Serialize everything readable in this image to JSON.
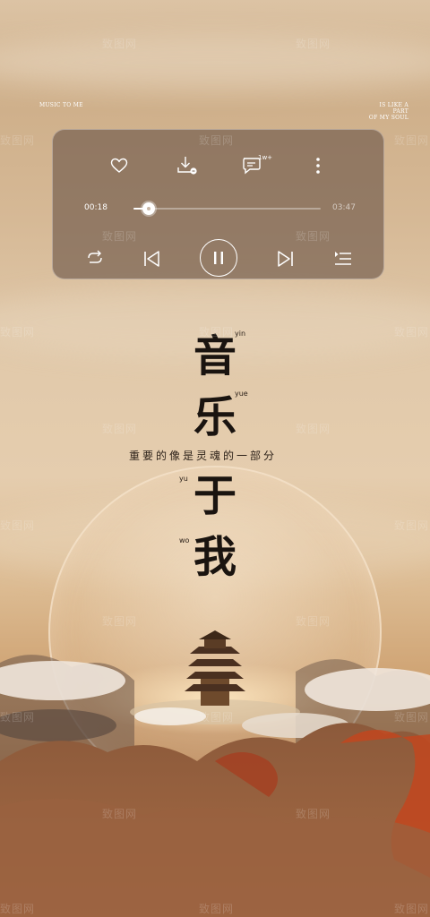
{
  "corner": {
    "left": "MUSIC TO ME",
    "right_line1": "IS LIKE A PART",
    "right_line2": "OF MY SOUL"
  },
  "player": {
    "elapsed": "00:18",
    "total": "03:47",
    "progress": 0.08,
    "comment_count": "1w+",
    "icons": {
      "like": "heart-icon",
      "download": "download-icon",
      "comment": "comment-icon",
      "more": "more-vertical-icon",
      "repeat": "repeat-icon",
      "previous": "skip-previous-icon",
      "pause": "pause-icon",
      "next": "skip-next-icon",
      "playlist": "playlist-icon"
    }
  },
  "title": {
    "chars": [
      "音",
      "乐",
      "于",
      "我"
    ],
    "pinyin": [
      "yin",
      "yue",
      "yu",
      "wo"
    ]
  },
  "subtitle": "重要的像是灵魂的一部分",
  "watermark": "致图网",
  "colors": {
    "accent_card": "#76604f",
    "text_dark": "#1a1410",
    "warm_orange": "#c2471e"
  }
}
